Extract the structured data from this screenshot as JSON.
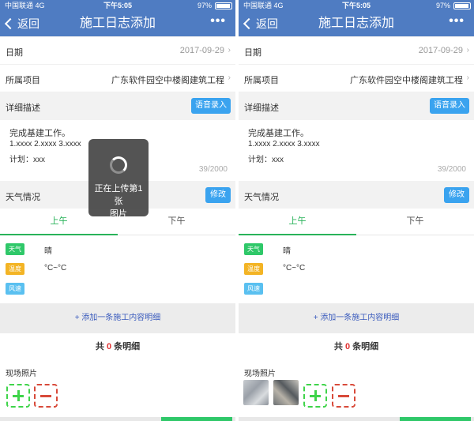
{
  "status": {
    "carrier": "中国联通",
    "network": "4G",
    "time": "下午5:05",
    "battery": "97%"
  },
  "nav": {
    "back_label": "返回",
    "title": "施工日志添加",
    "more": "•••"
  },
  "form": {
    "date_label": "日期",
    "date_value": "2017-09-29",
    "project_label": "所属项目",
    "project_value": "广东软件园空中楼阁建筑工程",
    "desc_label": "详细描述",
    "voice_button": "语音录入",
    "desc_line1": "完成基建工作。",
    "desc_line2": "1.xxxx   2.xxxx   3.xxxx",
    "desc_line3": "计划：xxx",
    "desc_count": "39/2000",
    "weather_label": "天气情况",
    "edit_button": "修改"
  },
  "tabs": {
    "am": "上午",
    "pm": "下午"
  },
  "weather": {
    "tag_weather": "天气",
    "tag_temp": "温度",
    "tag_wind": "风速",
    "weather_value": "晴",
    "temp_value": "°C~°C",
    "wind_value": ""
  },
  "detail": {
    "add_label": "+ 添加一条施工内容明细",
    "total_prefix": "共",
    "total_count": "0",
    "total_suffix": "条明细"
  },
  "photos": {
    "label": "现场照片"
  },
  "loading": {
    "line1": "正在上传第1张",
    "line2": "图片"
  },
  "colors": {
    "header": "#4f7cc2",
    "accent_green": "#29b35a",
    "button_blue": "#3aa3ef"
  }
}
